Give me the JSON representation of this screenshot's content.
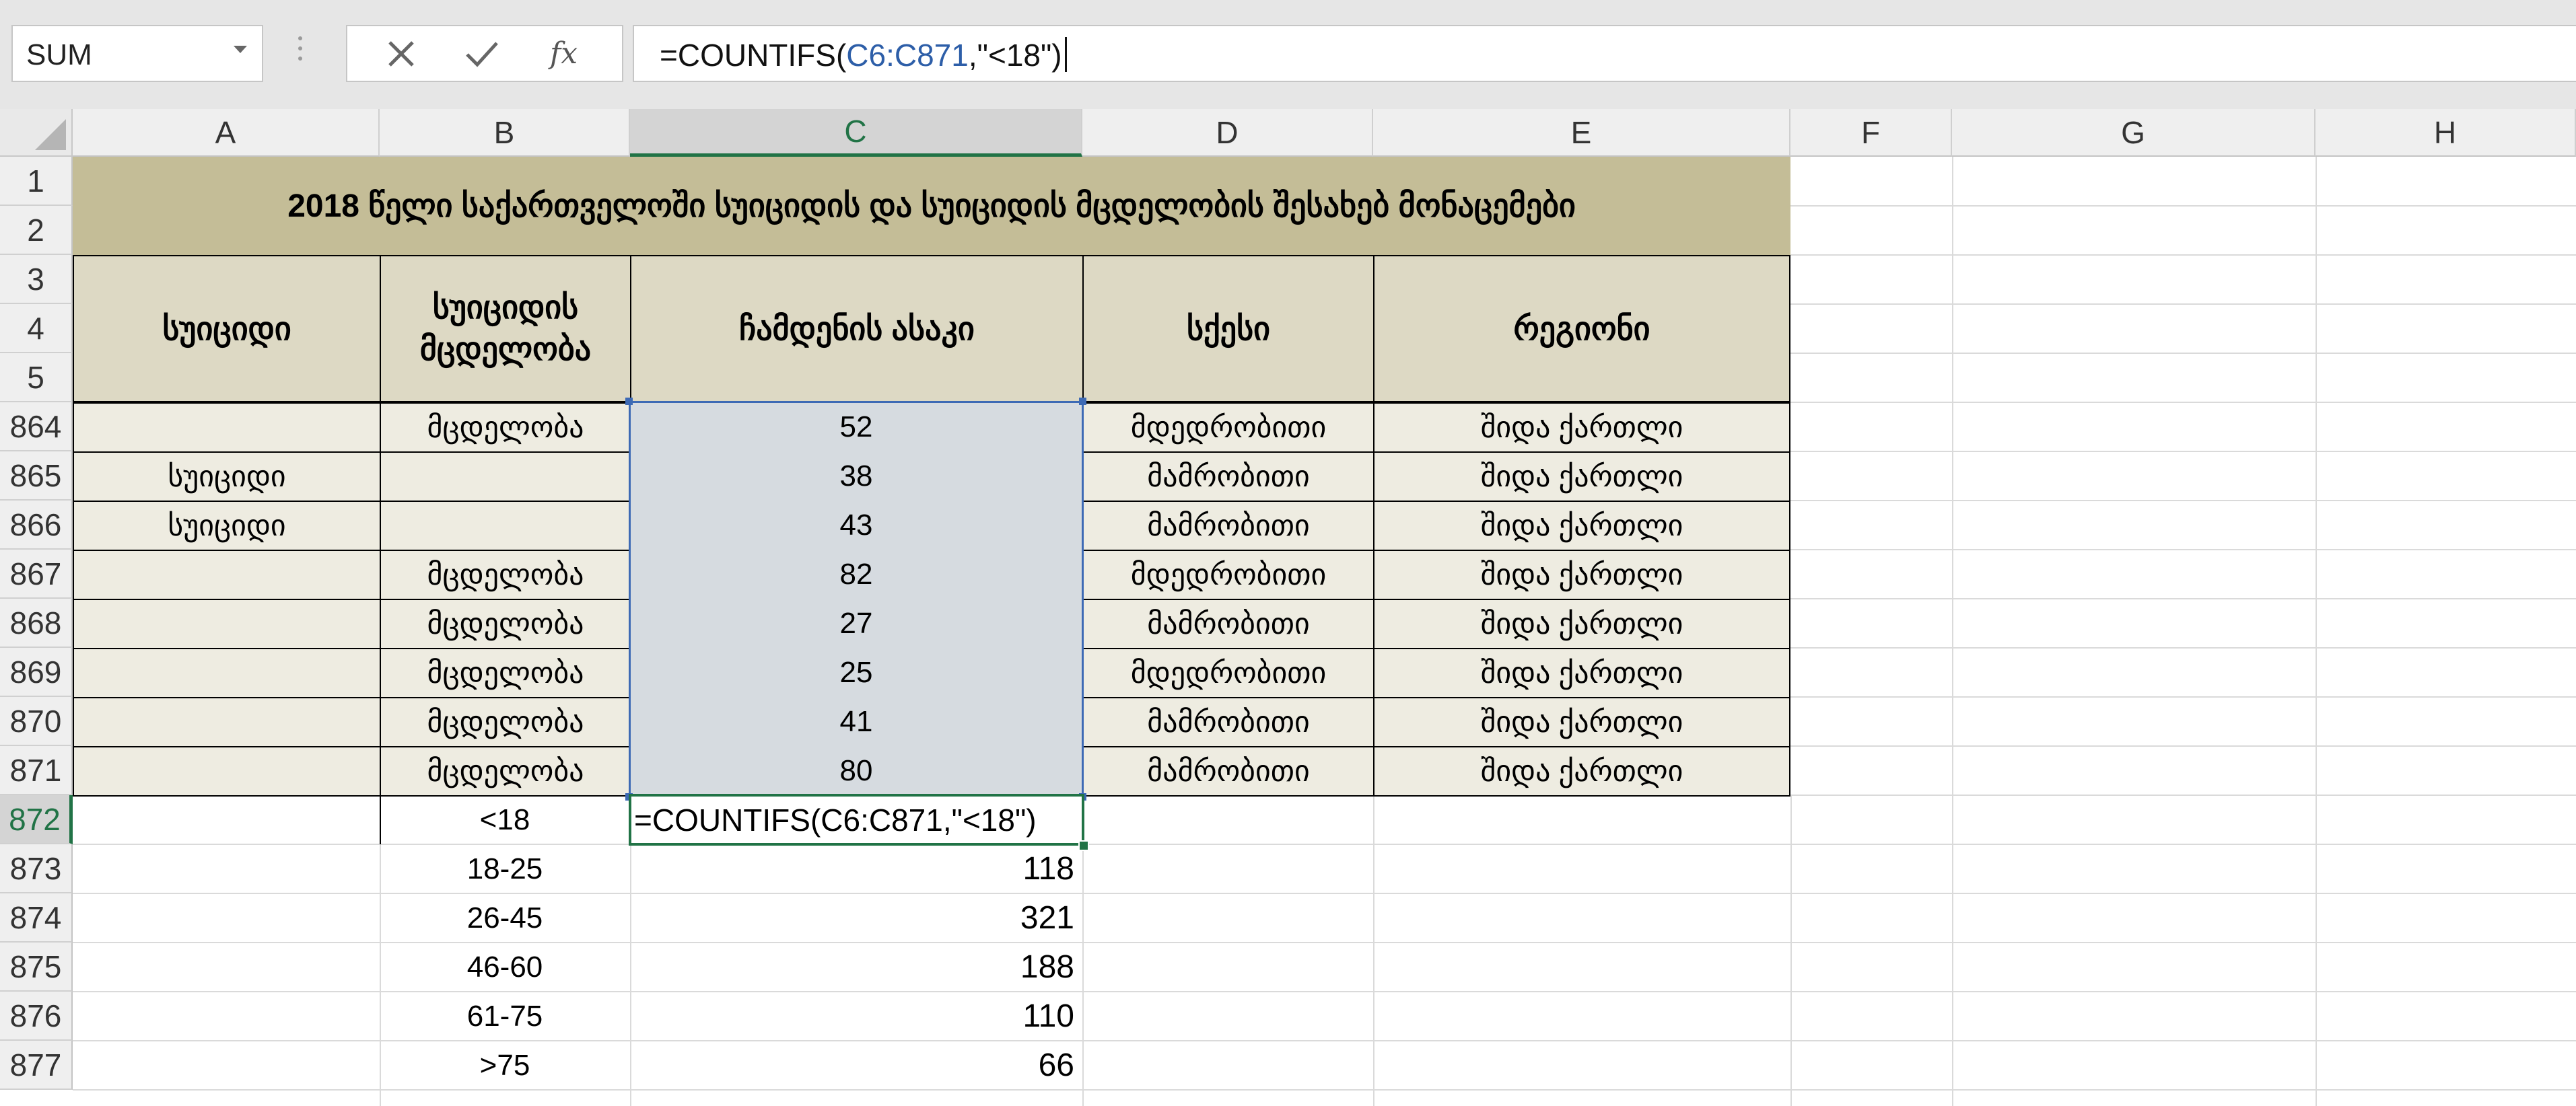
{
  "formula_bar": {
    "name_box": "SUM",
    "formula_parts": [
      "=COUNTIFS(",
      "C6:C871",
      ",\"<18\")"
    ]
  },
  "icons": {
    "cancel": "close-icon",
    "enter": "check-icon",
    "insert_function": "fx-icon"
  },
  "columns": [
    "A",
    "B",
    "C",
    "D",
    "E",
    "F",
    "G",
    "H"
  ],
  "row_numbers": [
    "1",
    "2",
    "3",
    "4",
    "5",
    "864",
    "865",
    "866",
    "867",
    "868",
    "869",
    "870",
    "871",
    "872",
    "873",
    "874",
    "875",
    "876",
    "877"
  ],
  "table": {
    "title": "2018 წელი საქართველოში სუიციდის და სუიციდის მცდელობის შესახებ  მონაცემები",
    "headers": {
      "suicide": "სუიციდი",
      "attempt_line1": "სუიციდის",
      "attempt_line2": "მცდელობა",
      "age": "ჩამდენის ასაკი",
      "sex": "სქესი",
      "region": "რეგიონი"
    },
    "rows": [
      {
        "a": "",
        "b": "მცდელობა",
        "c": "52",
        "d": "მდედრობითი",
        "e": "შიდა ქართლი"
      },
      {
        "a": "სუიციდი",
        "b": "",
        "c": "38",
        "d": "მამრობითი",
        "e": "შიდა ქართლი"
      },
      {
        "a": "სუიციდი",
        "b": "",
        "c": "43",
        "d": "მამრობითი",
        "e": "შიდა ქართლი"
      },
      {
        "a": "",
        "b": "მცდელობა",
        "c": "82",
        "d": "მდედრობითი",
        "e": "შიდა ქართლი"
      },
      {
        "a": "",
        "b": "მცდელობა",
        "c": "27",
        "d": "მამრობითი",
        "e": "შიდა ქართლი"
      },
      {
        "a": "",
        "b": "მცდელობა",
        "c": "25",
        "d": "მდედრობითი",
        "e": "შიდა ქართლი"
      },
      {
        "a": "",
        "b": "მცდელობა",
        "c": "41",
        "d": "მამრობითი",
        "e": "შიდა ქართლი"
      },
      {
        "a": "",
        "b": "მცდელობა",
        "c": "80",
        "d": "მამრობითი",
        "e": "შიდა ქართლი"
      }
    ]
  },
  "summary": {
    "active_cell_formula": "=COUNTIFS(C6:C871,\"<18\")",
    "rows": [
      {
        "label": "<18",
        "value": ""
      },
      {
        "label": "18-25",
        "value": "118"
      },
      {
        "label": "26-45",
        "value": "321"
      },
      {
        "label": "46-60",
        "value": "188"
      },
      {
        "label": "61-75",
        "value": "110"
      },
      {
        "label": ">75",
        "value": "66"
      }
    ]
  }
}
